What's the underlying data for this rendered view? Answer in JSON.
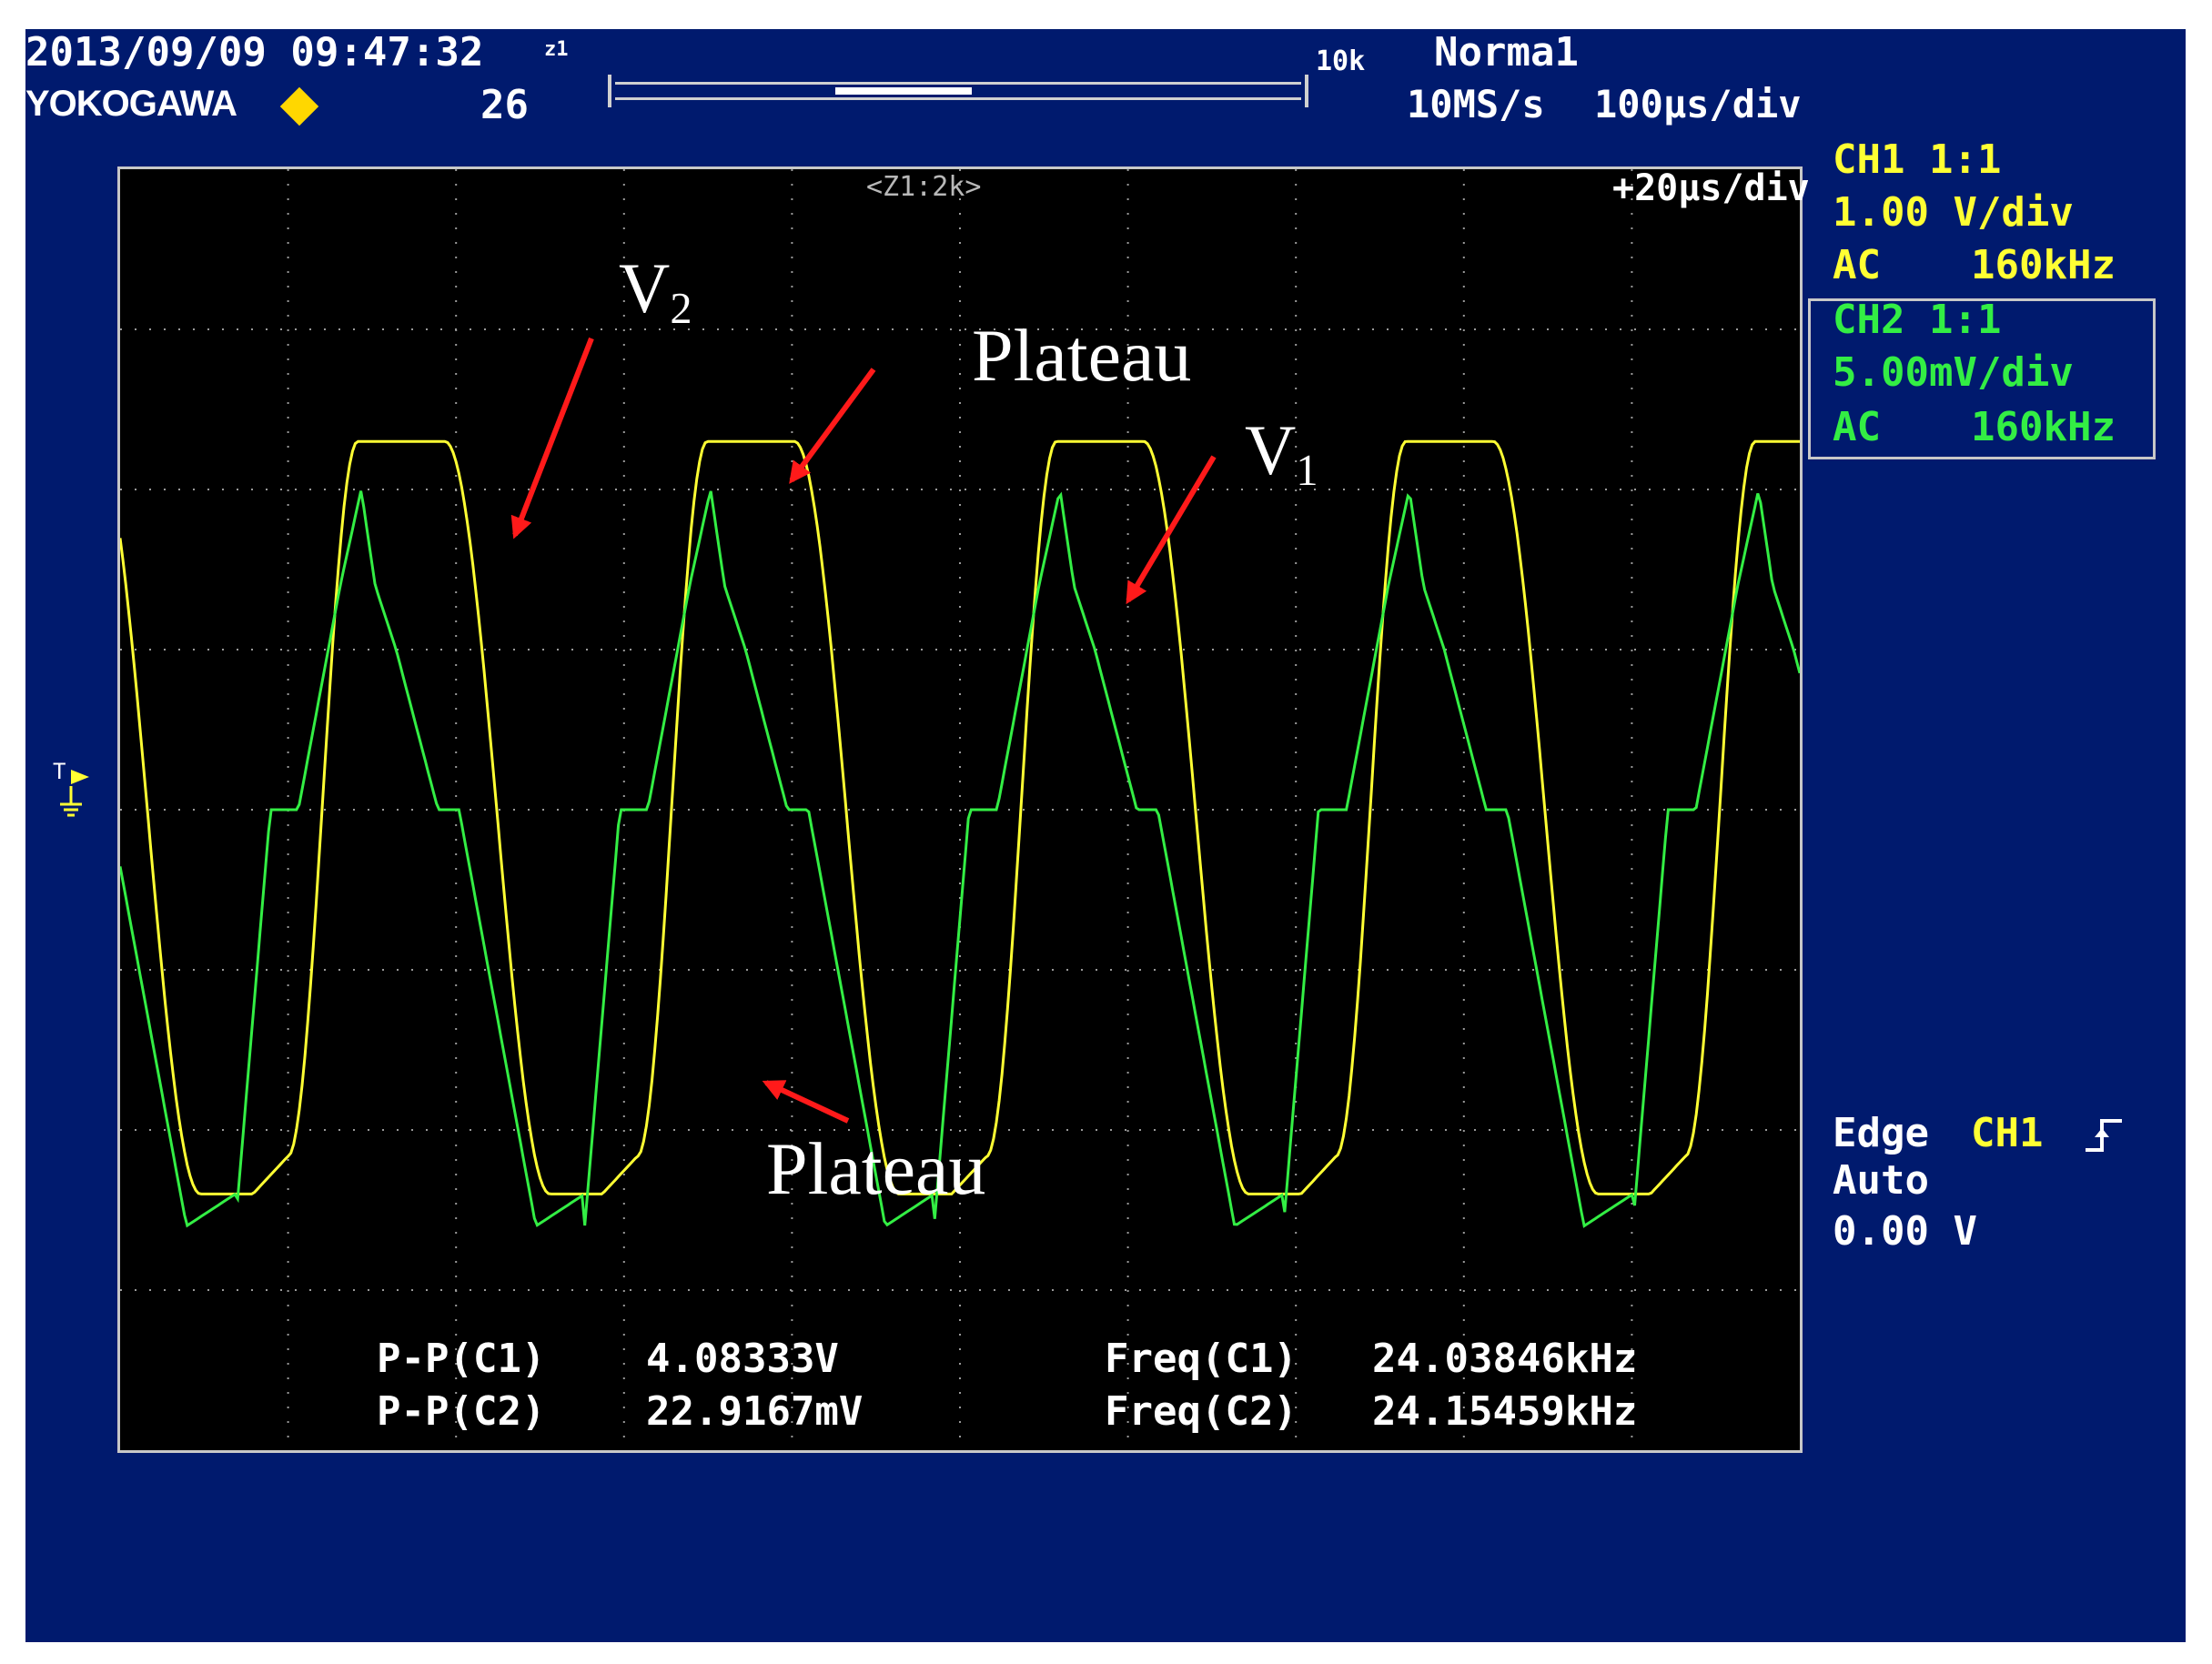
{
  "header": {
    "datetime": "2013/09/09 09:47:32",
    "zoom_marker": "z1",
    "record_length": "10k",
    "trigger_mode": "Norma1",
    "brand": "YOKOGAWA",
    "acq_count": "26",
    "sample_rate": "10MS/s",
    "timebase": "100μs/div",
    "zoom_label": "<Z1:2k>",
    "zoom_timebase": "+20μs/div"
  },
  "channels": {
    "ch1": {
      "name": "CH1 1:1",
      "scale": "1.00 V/div",
      "coupling": "AC",
      "bandwidth": "160kHz",
      "color": "#ffff33"
    },
    "ch2": {
      "name": "CH2 1:1",
      "scale": "5.00mV/div",
      "coupling": "AC",
      "bandwidth": "160kHz",
      "color": "#33ee44"
    }
  },
  "trigger": {
    "type": "Edge",
    "source": "CH1",
    "slope_icon": "rising-edge-icon",
    "mode": "Auto",
    "level": "0.00 V"
  },
  "measurements": [
    {
      "label": "P-P(C1)",
      "value": "4.08333V"
    },
    {
      "label": "P-P(C2)",
      "value": "22.9167mV"
    },
    {
      "label": "Freq(C1)",
      "value": "24.03846kHz"
    },
    {
      "label": "Freq(C2)",
      "value": "24.15459kHz"
    }
  ],
  "annotations": {
    "v2": {
      "main": "V",
      "sub": "2"
    },
    "v1": {
      "main": "V",
      "sub": "1"
    },
    "plateau_top": "Plateau",
    "plateau_bottom": "Plateau",
    "arrow_color": "#ff1a1a"
  },
  "chart_data": {
    "type": "line",
    "x_unit": "μs",
    "x_range": [
      0,
      200
    ],
    "y_divisions": [
      -4,
      4
    ],
    "grid": true,
    "series": [
      {
        "name": "CH1",
        "color": "#ffff33",
        "shape": "trapezoid",
        "frequency_khz": 24.03846,
        "peak_to_peak_v": 4.08333
      },
      {
        "name": "CH2",
        "color": "#33ee44",
        "shape": "triangular-with-steps",
        "frequency_khz": 24.15459,
        "peak_to_peak_mv": 22.9167
      }
    ]
  }
}
